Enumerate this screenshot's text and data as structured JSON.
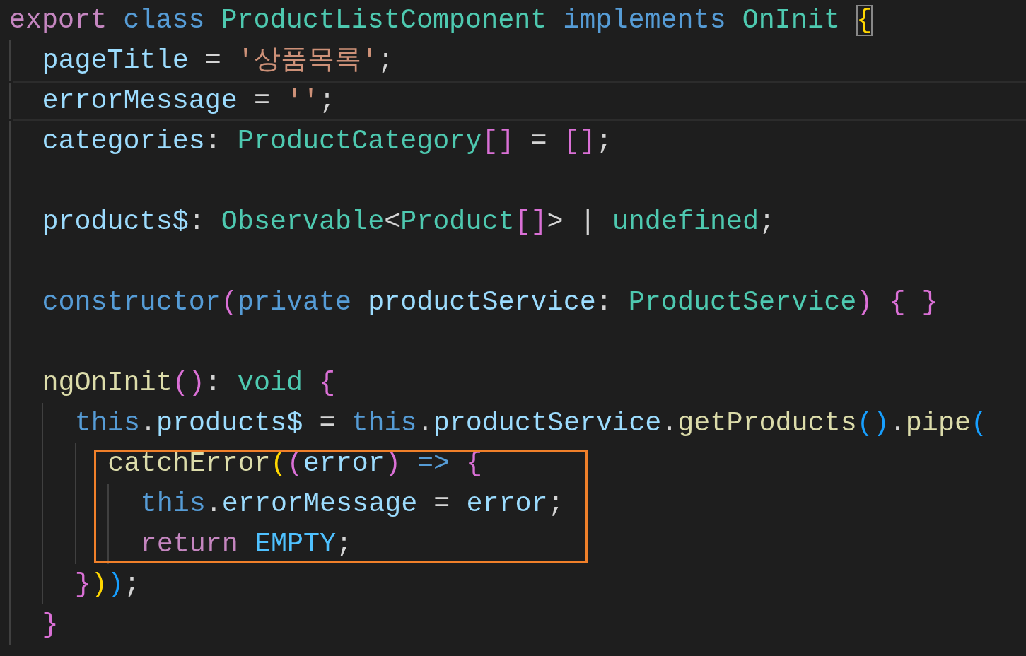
{
  "editor": {
    "lines": [
      {
        "kind": "level0",
        "current": false,
        "boxed": false,
        "tokens": [
          {
            "kind": "ctrl",
            "text": "export "
          },
          {
            "kind": "kw",
            "text": "class "
          },
          {
            "kind": "type",
            "text": "ProductListComponent "
          },
          {
            "kind": "kw",
            "text": "implements "
          },
          {
            "kind": "type",
            "text": "OnInit "
          },
          {
            "kind": "br1_match",
            "text": "{"
          }
        ]
      },
      {
        "kind": "level1",
        "current": false,
        "boxed": false,
        "tokens": [
          {
            "kind": "var",
            "text": "pageTitle"
          },
          {
            "kind": "plain",
            "text": " = "
          },
          {
            "kind": "str",
            "text": "'상품목록'"
          },
          {
            "kind": "plain",
            "text": ";"
          }
        ]
      },
      {
        "kind": "level1",
        "current": true,
        "boxed": false,
        "tokens": [
          {
            "kind": "var",
            "text": "errorMessage"
          },
          {
            "kind": "plain",
            "text": " = "
          },
          {
            "kind": "str",
            "text": "''"
          },
          {
            "kind": "plain",
            "text": ";"
          }
        ]
      },
      {
        "kind": "level1",
        "current": false,
        "boxed": false,
        "tokens": [
          {
            "kind": "var",
            "text": "categories"
          },
          {
            "kind": "plain",
            "text": ": "
          },
          {
            "kind": "type",
            "text": "ProductCategory"
          },
          {
            "kind": "br2",
            "text": "[]"
          },
          {
            "kind": "plain",
            "text": " = "
          },
          {
            "kind": "br2",
            "text": "[]"
          },
          {
            "kind": "plain",
            "text": ";"
          }
        ]
      },
      {
        "kind": "level1",
        "current": false,
        "boxed": false
      },
      {
        "kind": "level1",
        "current": false,
        "boxed": false,
        "tokens": [
          {
            "kind": "var",
            "text": "products$"
          },
          {
            "kind": "plain",
            "text": ": "
          },
          {
            "kind": "type",
            "text": "Observable"
          },
          {
            "kind": "plain",
            "text": "<"
          },
          {
            "kind": "type",
            "text": "Product"
          },
          {
            "kind": "br2",
            "text": "[]"
          },
          {
            "kind": "plain",
            "text": "> | "
          },
          {
            "kind": "type",
            "text": "undefined"
          },
          {
            "kind": "plain",
            "text": ";"
          }
        ]
      },
      {
        "kind": "level1",
        "current": false,
        "boxed": false
      },
      {
        "kind": "level1",
        "current": false,
        "boxed": false,
        "tokens": [
          {
            "kind": "kw",
            "text": "constructor"
          },
          {
            "kind": "br2",
            "text": "("
          },
          {
            "kind": "kw",
            "text": "private "
          },
          {
            "kind": "var",
            "text": "productService"
          },
          {
            "kind": "plain",
            "text": ": "
          },
          {
            "kind": "type",
            "text": "ProductService"
          },
          {
            "kind": "br2",
            "text": ")"
          },
          {
            "kind": "br2",
            "text": " { }"
          }
        ]
      },
      {
        "kind": "level1",
        "current": false,
        "boxed": false
      },
      {
        "kind": "level1",
        "current": false,
        "boxed": false,
        "tokens": [
          {
            "kind": "fn",
            "text": "ngOnInit"
          },
          {
            "kind": "br2",
            "text": "()"
          },
          {
            "kind": "plain",
            "text": ": "
          },
          {
            "kind": "type",
            "text": "void "
          },
          {
            "kind": "br2",
            "text": "{"
          }
        ]
      },
      {
        "kind": "level2",
        "current": false,
        "boxed": false,
        "tokens": [
          {
            "kind": "kw",
            "text": "this"
          },
          {
            "kind": "plain",
            "text": "."
          },
          {
            "kind": "var",
            "text": "products$"
          },
          {
            "kind": "plain",
            "text": " = "
          },
          {
            "kind": "kw",
            "text": "this"
          },
          {
            "kind": "plain",
            "text": "."
          },
          {
            "kind": "var",
            "text": "productService"
          },
          {
            "kind": "plain",
            "text": "."
          },
          {
            "kind": "fn",
            "text": "getProducts"
          },
          {
            "kind": "br3",
            "text": "()"
          },
          {
            "kind": "plain",
            "text": "."
          },
          {
            "kind": "fn",
            "text": "pipe"
          },
          {
            "kind": "br3",
            "text": "("
          }
        ]
      },
      {
        "kind": "level3",
        "current": false,
        "boxed": true,
        "tokens": [
          {
            "kind": "fn",
            "text": "catchError"
          },
          {
            "kind": "br1",
            "text": "("
          },
          {
            "kind": "br2",
            "text": "("
          },
          {
            "kind": "var",
            "text": "error"
          },
          {
            "kind": "br2",
            "text": ")"
          },
          {
            "kind": "kw",
            "text": " => "
          },
          {
            "kind": "br2",
            "text": "{"
          }
        ]
      },
      {
        "kind": "level4",
        "current": false,
        "boxed": true,
        "tokens": [
          {
            "kind": "kw",
            "text": "this"
          },
          {
            "kind": "plain",
            "text": "."
          },
          {
            "kind": "var",
            "text": "errorMessage"
          },
          {
            "kind": "plain",
            "text": " = "
          },
          {
            "kind": "var",
            "text": "error"
          },
          {
            "kind": "plain",
            "text": ";"
          }
        ]
      },
      {
        "kind": "level4",
        "current": false,
        "boxed": true,
        "tokens": [
          {
            "kind": "ctrl",
            "text": "return "
          },
          {
            "kind": "const",
            "text": "EMPTY"
          },
          {
            "kind": "plain",
            "text": ";"
          }
        ]
      },
      {
        "kind": "level2",
        "current": false,
        "boxed": false,
        "tokens": [
          {
            "kind": "br2",
            "text": "}"
          },
          {
            "kind": "br1",
            "text": ")"
          },
          {
            "kind": "br3",
            "text": ")"
          },
          {
            "kind": "plain",
            "text": ";"
          }
        ]
      },
      {
        "kind": "level1",
        "current": false,
        "boxed": false,
        "tokens": [
          {
            "kind": "br2",
            "text": "}"
          }
        ]
      }
    ]
  }
}
